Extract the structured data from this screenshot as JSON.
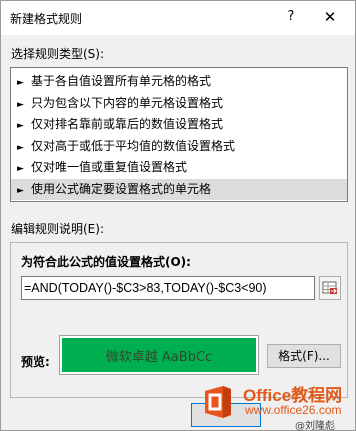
{
  "window": {
    "title": "新建格式规则",
    "help": "?",
    "close": "✕"
  },
  "rule_type": {
    "label": "选择规则类型(S):",
    "items": [
      {
        "label": "基于各自值设置所有单元格的格式"
      },
      {
        "label": "只为包含以下内容的单元格设置格式"
      },
      {
        "label": "仅对排名靠前或靠后的数值设置格式"
      },
      {
        "label": "仅对高于或低于平均值的数值设置格式"
      },
      {
        "label": "仅对唯一值或重复值设置格式"
      },
      {
        "label": "使用公式确定要设置格式的单元格",
        "selected": true
      }
    ],
    "arrow": "►"
  },
  "description": {
    "label": "编辑规则说明(E):",
    "formula_label": "为符合此公式的值设置格式(O):",
    "formula_value": "=AND(TODAY()-$C3>83,TODAY()-$C3<90)",
    "preview_label": "预览:",
    "preview_text": "微软卓越  AaBbCc",
    "preview_fill": "#00b050",
    "format_button": "格式(F)..."
  },
  "watermark": {
    "brand": "Office教程网",
    "url": "www.office26.com",
    "credit": "@刘隆彪"
  }
}
